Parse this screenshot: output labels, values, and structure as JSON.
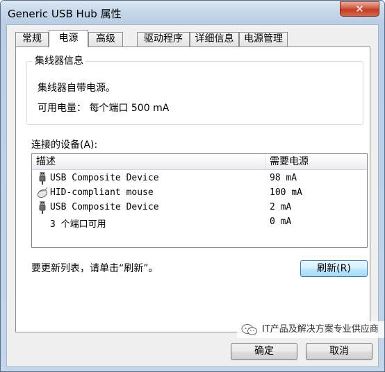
{
  "window": {
    "title": "Generic USB Hub 属性",
    "close_glyph": "✕"
  },
  "tabs": [
    {
      "label": "常规"
    },
    {
      "label": "电源"
    },
    {
      "label": "高级"
    },
    {
      "label": "驱动程序"
    },
    {
      "label": "详细信息"
    },
    {
      "label": "电源管理"
    }
  ],
  "active_tab": "电源",
  "hub_info": {
    "title": "集线器信息",
    "self_powered": "集线器自带电源。",
    "available_power_label": "可用电量：",
    "available_power_value": "每个端口 500 mA"
  },
  "devices": {
    "label": "连接的设备(A):",
    "columns": [
      "描述",
      "需要电源"
    ],
    "rows": [
      {
        "icon": "usb-plug-icon",
        "name": "USB Composite Device",
        "power": "98 mA"
      },
      {
        "icon": "mouse-icon",
        "name": "HID-compliant mouse",
        "power": "100 mA"
      },
      {
        "icon": "usb-plug-icon",
        "name": "USB Composite Device",
        "power": "2 mA"
      },
      {
        "icon": "",
        "name": "3 个端口可用",
        "power": "0 mA"
      }
    ]
  },
  "refresh": {
    "hint": "要更新列表，请单击“刷新”。",
    "button": "刷新(R)"
  },
  "footer": {
    "ok": "确定",
    "cancel": "取消"
  },
  "watermark": {
    "text": "IT产品及解决方案专业供应商"
  },
  "colors": {
    "title_gradient_top": "#dce8f4",
    "close_button_red": "#c23b22",
    "refresh_button_border": "#3c7fb1",
    "panel_background": "#ffffff",
    "dialog_background": "#f0f0f0"
  }
}
